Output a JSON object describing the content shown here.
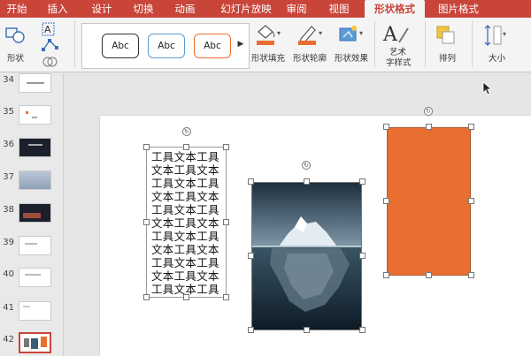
{
  "ribbon_tabs": [
    {
      "label": "开始"
    },
    {
      "label": "插入"
    },
    {
      "label": "设计"
    },
    {
      "label": "切换"
    },
    {
      "label": "动画"
    },
    {
      "label": "幻灯片放映"
    },
    {
      "label": "审阅"
    },
    {
      "label": "视图"
    },
    {
      "label": "形状格式"
    },
    {
      "label": "图片格式"
    }
  ],
  "active_tab": "形状格式",
  "ribbon": {
    "shape_label": "形状",
    "style_gallery": [
      "Abc",
      "Abc",
      "Abc"
    ],
    "fill_label": "形状填充",
    "outline_label": "形状轮廓",
    "effect_label": "形状效果",
    "wordart_label_1": "艺术",
    "wordart_label_2": "字样式",
    "arrange_label": "排列",
    "size_label": "大小"
  },
  "slides": [
    {
      "num": "34"
    },
    {
      "num": "35"
    },
    {
      "num": "36"
    },
    {
      "num": "37"
    },
    {
      "num": "38"
    },
    {
      "num": "39"
    },
    {
      "num": "40"
    },
    {
      "num": "41"
    },
    {
      "num": "42"
    }
  ],
  "textbox_lines": [
    "工具文本工具",
    "文本工具文本",
    "工具文本工具",
    "文本工具文本",
    "工具文本工具",
    "文本工具文本",
    "工具文本工具",
    "文本工具文本",
    "工具文本工具",
    "文本工具文本",
    "工具文本工具"
  ],
  "colors": {
    "accent": "#c9453a",
    "rectangle_fill": "#e86f31",
    "outline_pen": "#e86f31",
    "fill_bucket": "#e86f31"
  }
}
